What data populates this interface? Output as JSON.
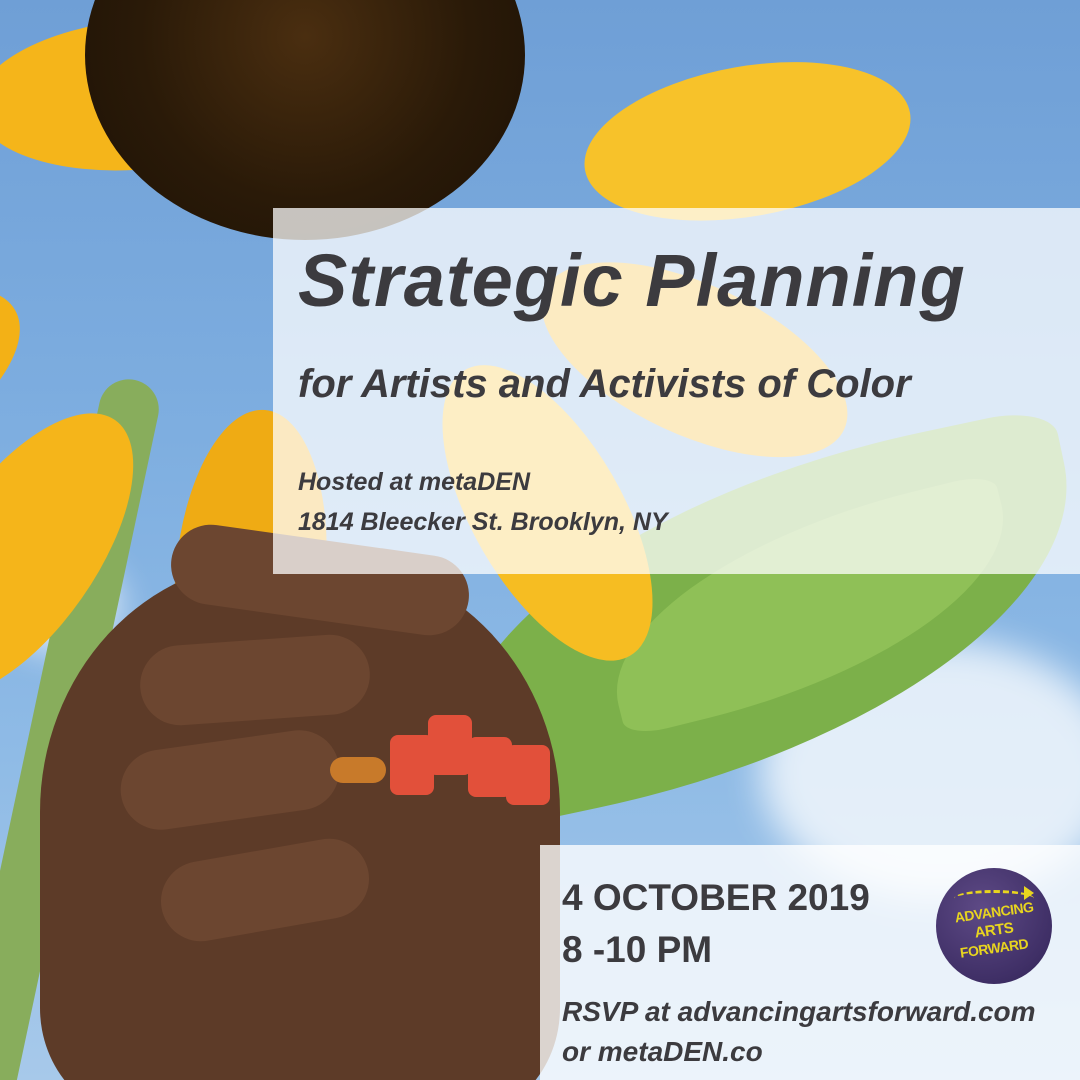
{
  "event": {
    "title": "Strategic Planning",
    "subtitle": "for Artists and Activists of Color",
    "venue_line1": "Hosted at metaDEN",
    "venue_line2": "1814 Bleecker St. Brooklyn, NY",
    "date": "4 OCTOBER 2019",
    "time": "8 -10 PM",
    "rsvp_line1": "RSVP at advancingartsforward.com",
    "rsvp_line2": "or metaDEN.co"
  },
  "logo": {
    "line1": "ADVANCING",
    "line2": "ARTS",
    "line3": "FORWARD"
  },
  "colors": {
    "text": "#3c3b3f",
    "sky": "#7eaee0",
    "petal": "#f5b51a",
    "logo_bg": "#3f2f66",
    "logo_text": "#e8d51f"
  },
  "icons": [
    "sunflower-image",
    "advancing-arts-forward-logo"
  ]
}
